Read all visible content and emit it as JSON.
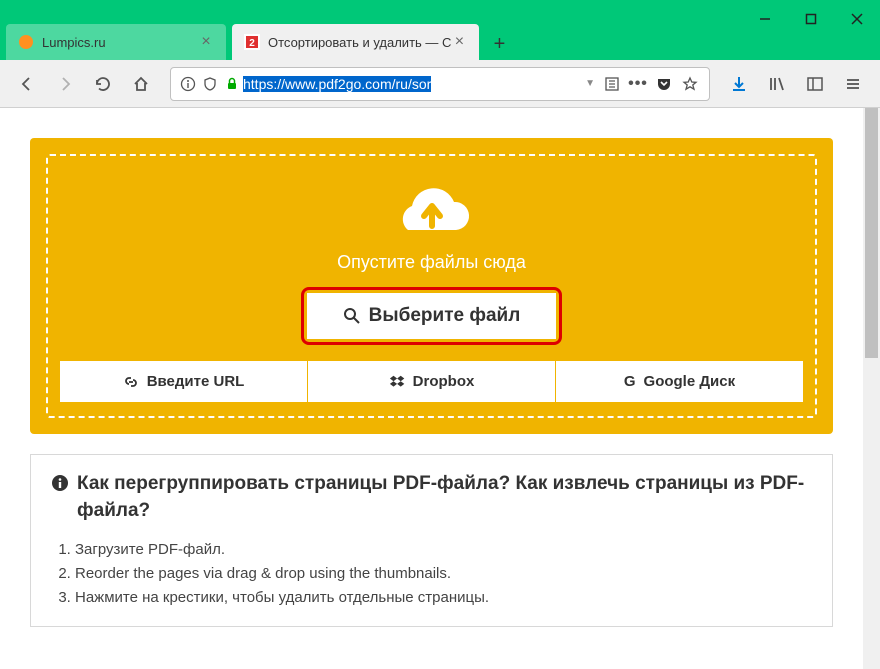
{
  "tabs": [
    {
      "title": "Lumpics.ru",
      "active": false
    },
    {
      "title": "Отсортировать и удалить — С",
      "active": true
    }
  ],
  "url": {
    "prefix": "https://www.pdf2go.com/ru/sor",
    "suffix": ""
  },
  "upload": {
    "drop_text": "Опустите файлы сюда",
    "choose_label": "Выберите файл",
    "source_url": "Введите URL",
    "source_dropbox": "Dropbox",
    "source_gdrive": "Google Диск"
  },
  "info": {
    "heading": "Как перегруппировать страницы PDF-файла? Как извлечь страницы из PDF-файла?",
    "steps": [
      "Загрузите PDF-файл.",
      "Reorder the pages via drag & drop using the thumbnails.",
      "Нажмите на крестики, чтобы удалить отдельные страницы."
    ]
  }
}
